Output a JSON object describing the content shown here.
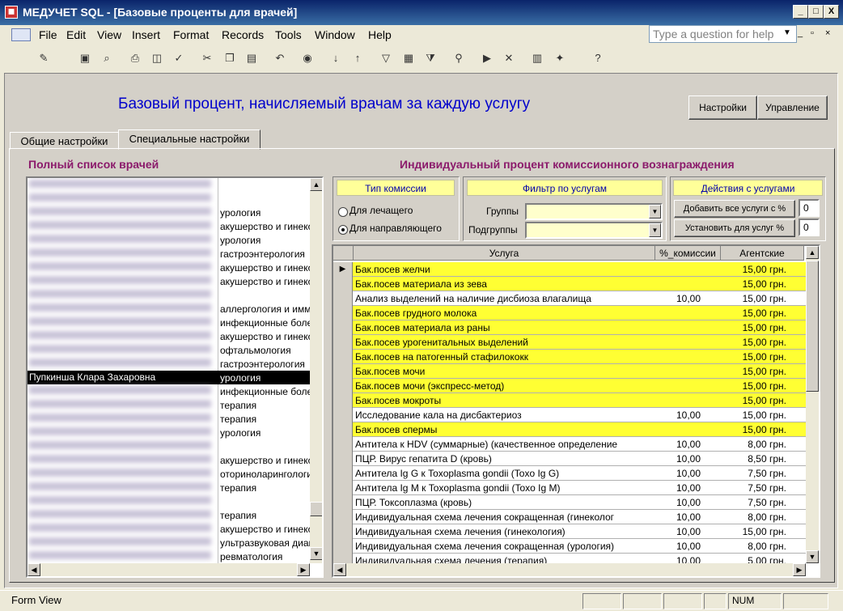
{
  "window": {
    "app_title": "МЕДУЧЕТ SQL - [Базовые проценты для врачей]",
    "minimize": "_",
    "restore": "□",
    "close": "X"
  },
  "menu": [
    "File",
    "Edit",
    "View",
    "Insert",
    "Format",
    "Records",
    "Tools",
    "Window",
    "Help"
  ],
  "help_placeholder": "Type a question for help",
  "form": {
    "title": "Базовый процент, начисляемый врачам за каждую услугу",
    "btn_settings": "Настройки",
    "btn_manage": "Управление"
  },
  "tabs": [
    "Общие настройки",
    "Специальные настройки"
  ],
  "left": {
    "heading": "Полный список врачей",
    "rows": [
      {
        "spec": ""
      },
      {
        "spec": ""
      },
      {
        "spec": "урология"
      },
      {
        "spec": "акушерство и гинекология"
      },
      {
        "spec": "урология"
      },
      {
        "spec": "гастроэнтерология"
      },
      {
        "spec": "акушерство и гинекология"
      },
      {
        "spec": "акушерство и гинекология"
      },
      {
        "spec": ""
      },
      {
        "spec": "аллергология и иммунология"
      },
      {
        "spec": "инфекционные болезни"
      },
      {
        "spec": "акушерство и гинекология"
      },
      {
        "spec": "офтальмология"
      },
      {
        "spec": "гастроэнтерология"
      },
      {
        "spec": "урология",
        "name": "Пупкинша Клара Захаровна",
        "selected": true
      },
      {
        "spec": "инфекционные болезни"
      },
      {
        "spec": "терапия"
      },
      {
        "spec": "терапия"
      },
      {
        "spec": "урология"
      },
      {
        "spec": ""
      },
      {
        "spec": "акушерство и гинекология"
      },
      {
        "spec": "оториноларингология"
      },
      {
        "spec": "терапия"
      },
      {
        "spec": ""
      },
      {
        "spec": "терапия"
      },
      {
        "spec": "акушерство и гинекология"
      },
      {
        "spec": "ультразвуковая диагностика"
      },
      {
        "spec": "ревматология"
      }
    ]
  },
  "right": {
    "heading": "Индивидуальный процент комиссионного вознаграждения",
    "commission": {
      "title": "Тип комиссии",
      "opt1": "Для лечащего",
      "opt2": "Для направляющего",
      "selected": "opt2"
    },
    "filter": {
      "title": "Фильтр по услугам",
      "groups_label": "Группы",
      "subgroups_label": "Подгруппы"
    },
    "actions": {
      "title": "Действия с услугами",
      "add_all": "Добавить все услуги с %",
      "set_for": "Установить для услуг %",
      "val1": "0",
      "val2": "0"
    }
  },
  "grid": {
    "headers": [
      "Услуга",
      "%_комиссии",
      "Агентские"
    ],
    "rows": [
      {
        "name": "Бак.посев желчи",
        "pct": "",
        "agent": "15,00 грн.",
        "hl": true,
        "current": true
      },
      {
        "name": "Бак.посев материала из зева",
        "pct": "",
        "agent": "15,00 грн.",
        "hl": true
      },
      {
        "name": "Анализ выделений на наличие дисбиоза влагалища",
        "pct": "10,00",
        "agent": "15,00 грн.",
        "hl": false
      },
      {
        "name": "Бак.посев грудного молока",
        "pct": "",
        "agent": "15,00 грн.",
        "hl": true
      },
      {
        "name": "Бак.посев материала из раны",
        "pct": "",
        "agent": "15,00 грн.",
        "hl": true
      },
      {
        "name": "Бак.посев урогенитальных выделений",
        "pct": "",
        "agent": "15,00 грн.",
        "hl": true
      },
      {
        "name": "Бак.посев на патогенный стафилококк",
        "pct": "",
        "agent": "15,00 грн.",
        "hl": true
      },
      {
        "name": "Бак.посев мочи",
        "pct": "",
        "agent": "15,00 грн.",
        "hl": true
      },
      {
        "name": "Бак.посев мочи (экспресс-метод)",
        "pct": "",
        "agent": "15,00 грн.",
        "hl": true
      },
      {
        "name": "Бак.посев мокроты",
        "pct": "",
        "agent": "15,00 грн.",
        "hl": true
      },
      {
        "name": "Исследование кала на дисбактериоз",
        "pct": "10,00",
        "agent": "15,00 грн.",
        "hl": false
      },
      {
        "name": "Бак.посев спермы",
        "pct": "",
        "agent": "15,00 грн.",
        "hl": true
      },
      {
        "name": "Антитела к HDV (суммарные) (качественное определение",
        "pct": "10,00",
        "agent": "8,00 грн.",
        "hl": false
      },
      {
        "name": "ПЦР. Вирус гепатита D (кровь)",
        "pct": "10,00",
        "agent": "8,50 грн.",
        "hl": false
      },
      {
        "name": "Антитела Ig G к Toxoplasma gondii (Toxo Ig G)",
        "pct": "10,00",
        "agent": "7,50 грн.",
        "hl": false
      },
      {
        "name": "Антитела Ig M к Toxoplasma gondii (Toxo Ig M)",
        "pct": "10,00",
        "agent": "7,50 грн.",
        "hl": false
      },
      {
        "name": "ПЦР. Токсоплазма (кровь)",
        "pct": "10,00",
        "agent": "7,50 грн.",
        "hl": false
      },
      {
        "name": "Индивидуальная схема лечения сокращенная (гинеколог",
        "pct": "10,00",
        "agent": "8,00 грн.",
        "hl": false
      },
      {
        "name": "Индивидуальная схема лечения  (гинекология)",
        "pct": "10,00",
        "agent": "15,00 грн.",
        "hl": false
      },
      {
        "name": "Индивидуальная схема лечения сокращенная (урология)",
        "pct": "10,00",
        "agent": "8,00 грн.",
        "hl": false
      },
      {
        "name": "Индивидуальная схема лечения (терапия)",
        "pct": "10,00",
        "agent": "5,00 грн.",
        "hl": false
      }
    ]
  },
  "status": {
    "left": "Form View",
    "num": "NUM"
  },
  "toolbar_icons": [
    "design-view-icon",
    "save-icon",
    "search-file-icon",
    "print-icon",
    "print-preview-icon",
    "spelling-icon",
    "cut-icon",
    "copy-icon",
    "paste-icon",
    "undo-icon",
    "hyperlink-icon",
    "sort-asc-icon",
    "sort-desc-icon",
    "filter-selection-icon",
    "filter-form-icon",
    "apply-filter-icon",
    "find-icon",
    "new-record-icon",
    "delete-record-icon",
    "database-window-icon",
    "new-object-icon",
    "help-icon"
  ]
}
